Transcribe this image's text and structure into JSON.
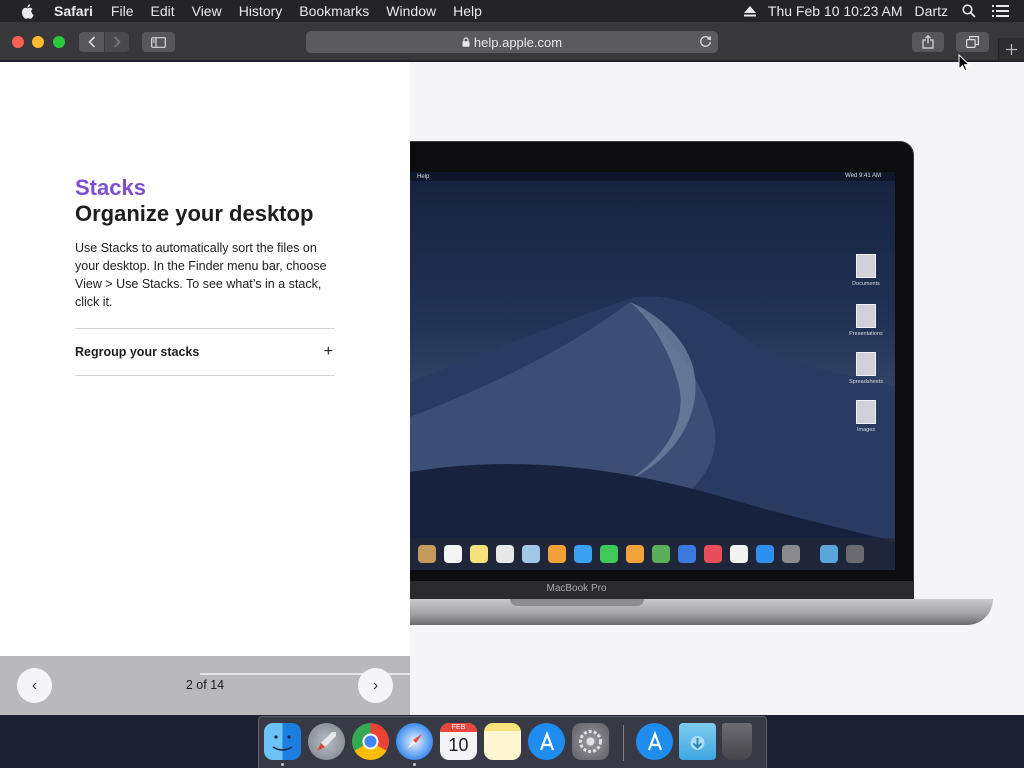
{
  "menubar": {
    "app_name": "Safari",
    "menus": [
      "File",
      "Edit",
      "View",
      "History",
      "Bookmarks",
      "Window",
      "Help"
    ],
    "clock": "Thu Feb 10  10:23 AM",
    "user": "Dartz"
  },
  "toolbar": {
    "address": "help.apple.com"
  },
  "content": {
    "eyebrow": "Stacks",
    "headline": "Organize your desktop",
    "body": "Use Stacks to automatically sort the files on your desktop. In the Finder menu bar, choose View > Use Stacks. To see what’s in a stack, click it.",
    "accordion_label": "Regroup your stacks",
    "accordion_icon": "+",
    "prev_icon": "‹",
    "next_icon": "›",
    "counter": "2 of 14"
  },
  "illustration": {
    "inner_menu_app": "Help",
    "inner_clock": "Wed 9:41 AM",
    "desktop_stacks": [
      "Documents",
      "Presentations",
      "Spreadsheets",
      "Images"
    ],
    "device_label": "MacBook Pro"
  },
  "dock": {
    "apps": [
      "finder",
      "launchpad",
      "chrome",
      "safari",
      "calendar",
      "notes",
      "app-store",
      "system-preferences",
      "app-store-download",
      "downloads-folder",
      "trash"
    ],
    "calendar_month": "FEB",
    "calendar_day": "10"
  },
  "colors": {
    "accent": "#7b4fd1",
    "menubar": "#242428",
    "toolbar": "#38383b"
  }
}
